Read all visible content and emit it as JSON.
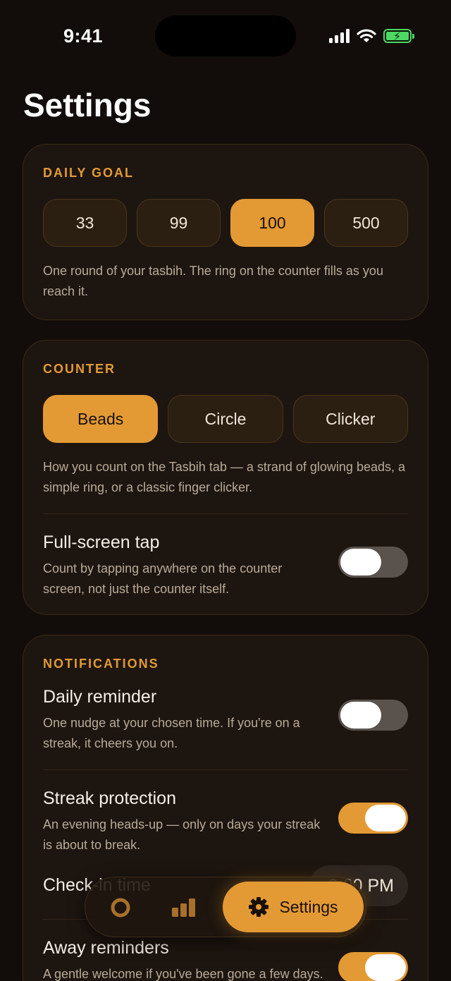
{
  "status_bar": {
    "time": "9:41"
  },
  "page": {
    "title": "Settings"
  },
  "daily_goal": {
    "title": "DAILY GOAL",
    "options": [
      "33",
      "99",
      "100",
      "500"
    ],
    "selected": "100",
    "hint": "One round of your tasbih. The ring on the counter fills as you reach it."
  },
  "counter": {
    "title": "COUNTER",
    "options": [
      "Beads",
      "Circle",
      "Clicker"
    ],
    "selected": "Beads",
    "hint": "How you count on the Tasbih tab — a strand of glowing beads, a simple ring, or a classic finger clicker.",
    "fullscreen_tap": {
      "title": "Full-screen tap",
      "desc": "Count by tapping anywhere on the counter screen, not just the counter itself.",
      "on": false
    }
  },
  "notifications": {
    "title": "NOTIFICATIONS",
    "daily_reminder": {
      "title": "Daily reminder",
      "desc": "One nudge at your chosen time. If you're on a streak, it cheers you on.",
      "on": false
    },
    "streak_protection": {
      "title": "Streak protection",
      "desc": "An evening heads-up — only on days your streak is about to break.",
      "on": true
    },
    "checkin_time": {
      "title": "Check-in time",
      "value": "9:00 PM"
    },
    "away_reminders": {
      "title": "Away reminders",
      "desc": "A gentle welcome if you've been gone a few days.",
      "on": true
    }
  },
  "tabbar": {
    "items": [
      {
        "name": "counter",
        "icon": "target-icon"
      },
      {
        "name": "stats",
        "icon": "bar-chart-icon"
      },
      {
        "name": "settings",
        "icon": "gear-icon",
        "label": "Settings",
        "active": true
      }
    ]
  },
  "colors": {
    "accent": "#e39a34",
    "background": "#120d0a",
    "card": "#1d1510"
  }
}
